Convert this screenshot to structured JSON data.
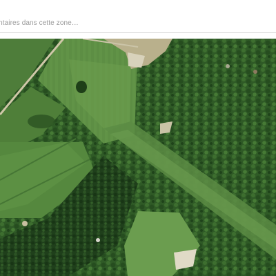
{
  "comment_field": {
    "placeholder": "…ntaires dans cette zone…",
    "value": ""
  },
  "map": {
    "type": "satellite"
  }
}
